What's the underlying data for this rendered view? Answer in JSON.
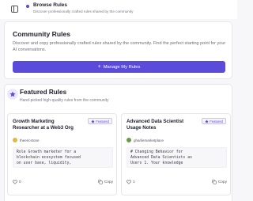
{
  "header": {
    "title": "Browse Rules",
    "subtitle": "Discover professionally crafted rules shared by the community"
  },
  "community": {
    "heading": "Community Rules",
    "description": "Discover and copy professionally crafted rules shared by the community. Find the perfect starting point for your AI conversations.",
    "manage_button": "Manage My Rules"
  },
  "featured": {
    "heading": "Featured Rules",
    "subtitle": "Hand-picked high-quality rules from the community",
    "rules": [
      {
        "title": "Growth Marketing Researcher at a Web3 Org",
        "tag": "Featured",
        "author": "theericstone",
        "preview_lines": [
          "Role Growth marketer for a",
          "blockchain ecosystem focused",
          "on user base, liquidity,"
        ],
        "likes": "0",
        "copy_label": "Copy"
      },
      {
        "title": "Advanced Data Scientist Usage Notes",
        "tag": "Featured",
        "author": "gharliemarketplace",
        "preview_lines": [
          "# Changing Behavior for",
          "Advanced Data Scientists as",
          "Users 1. Your knowledge"
        ],
        "likes": "1",
        "copy_label": "Copy"
      }
    ]
  },
  "colors": {
    "accent": "#5b4bdb",
    "avatar_1": "#e0b84a",
    "avatar_2": "#6a9a4a"
  }
}
